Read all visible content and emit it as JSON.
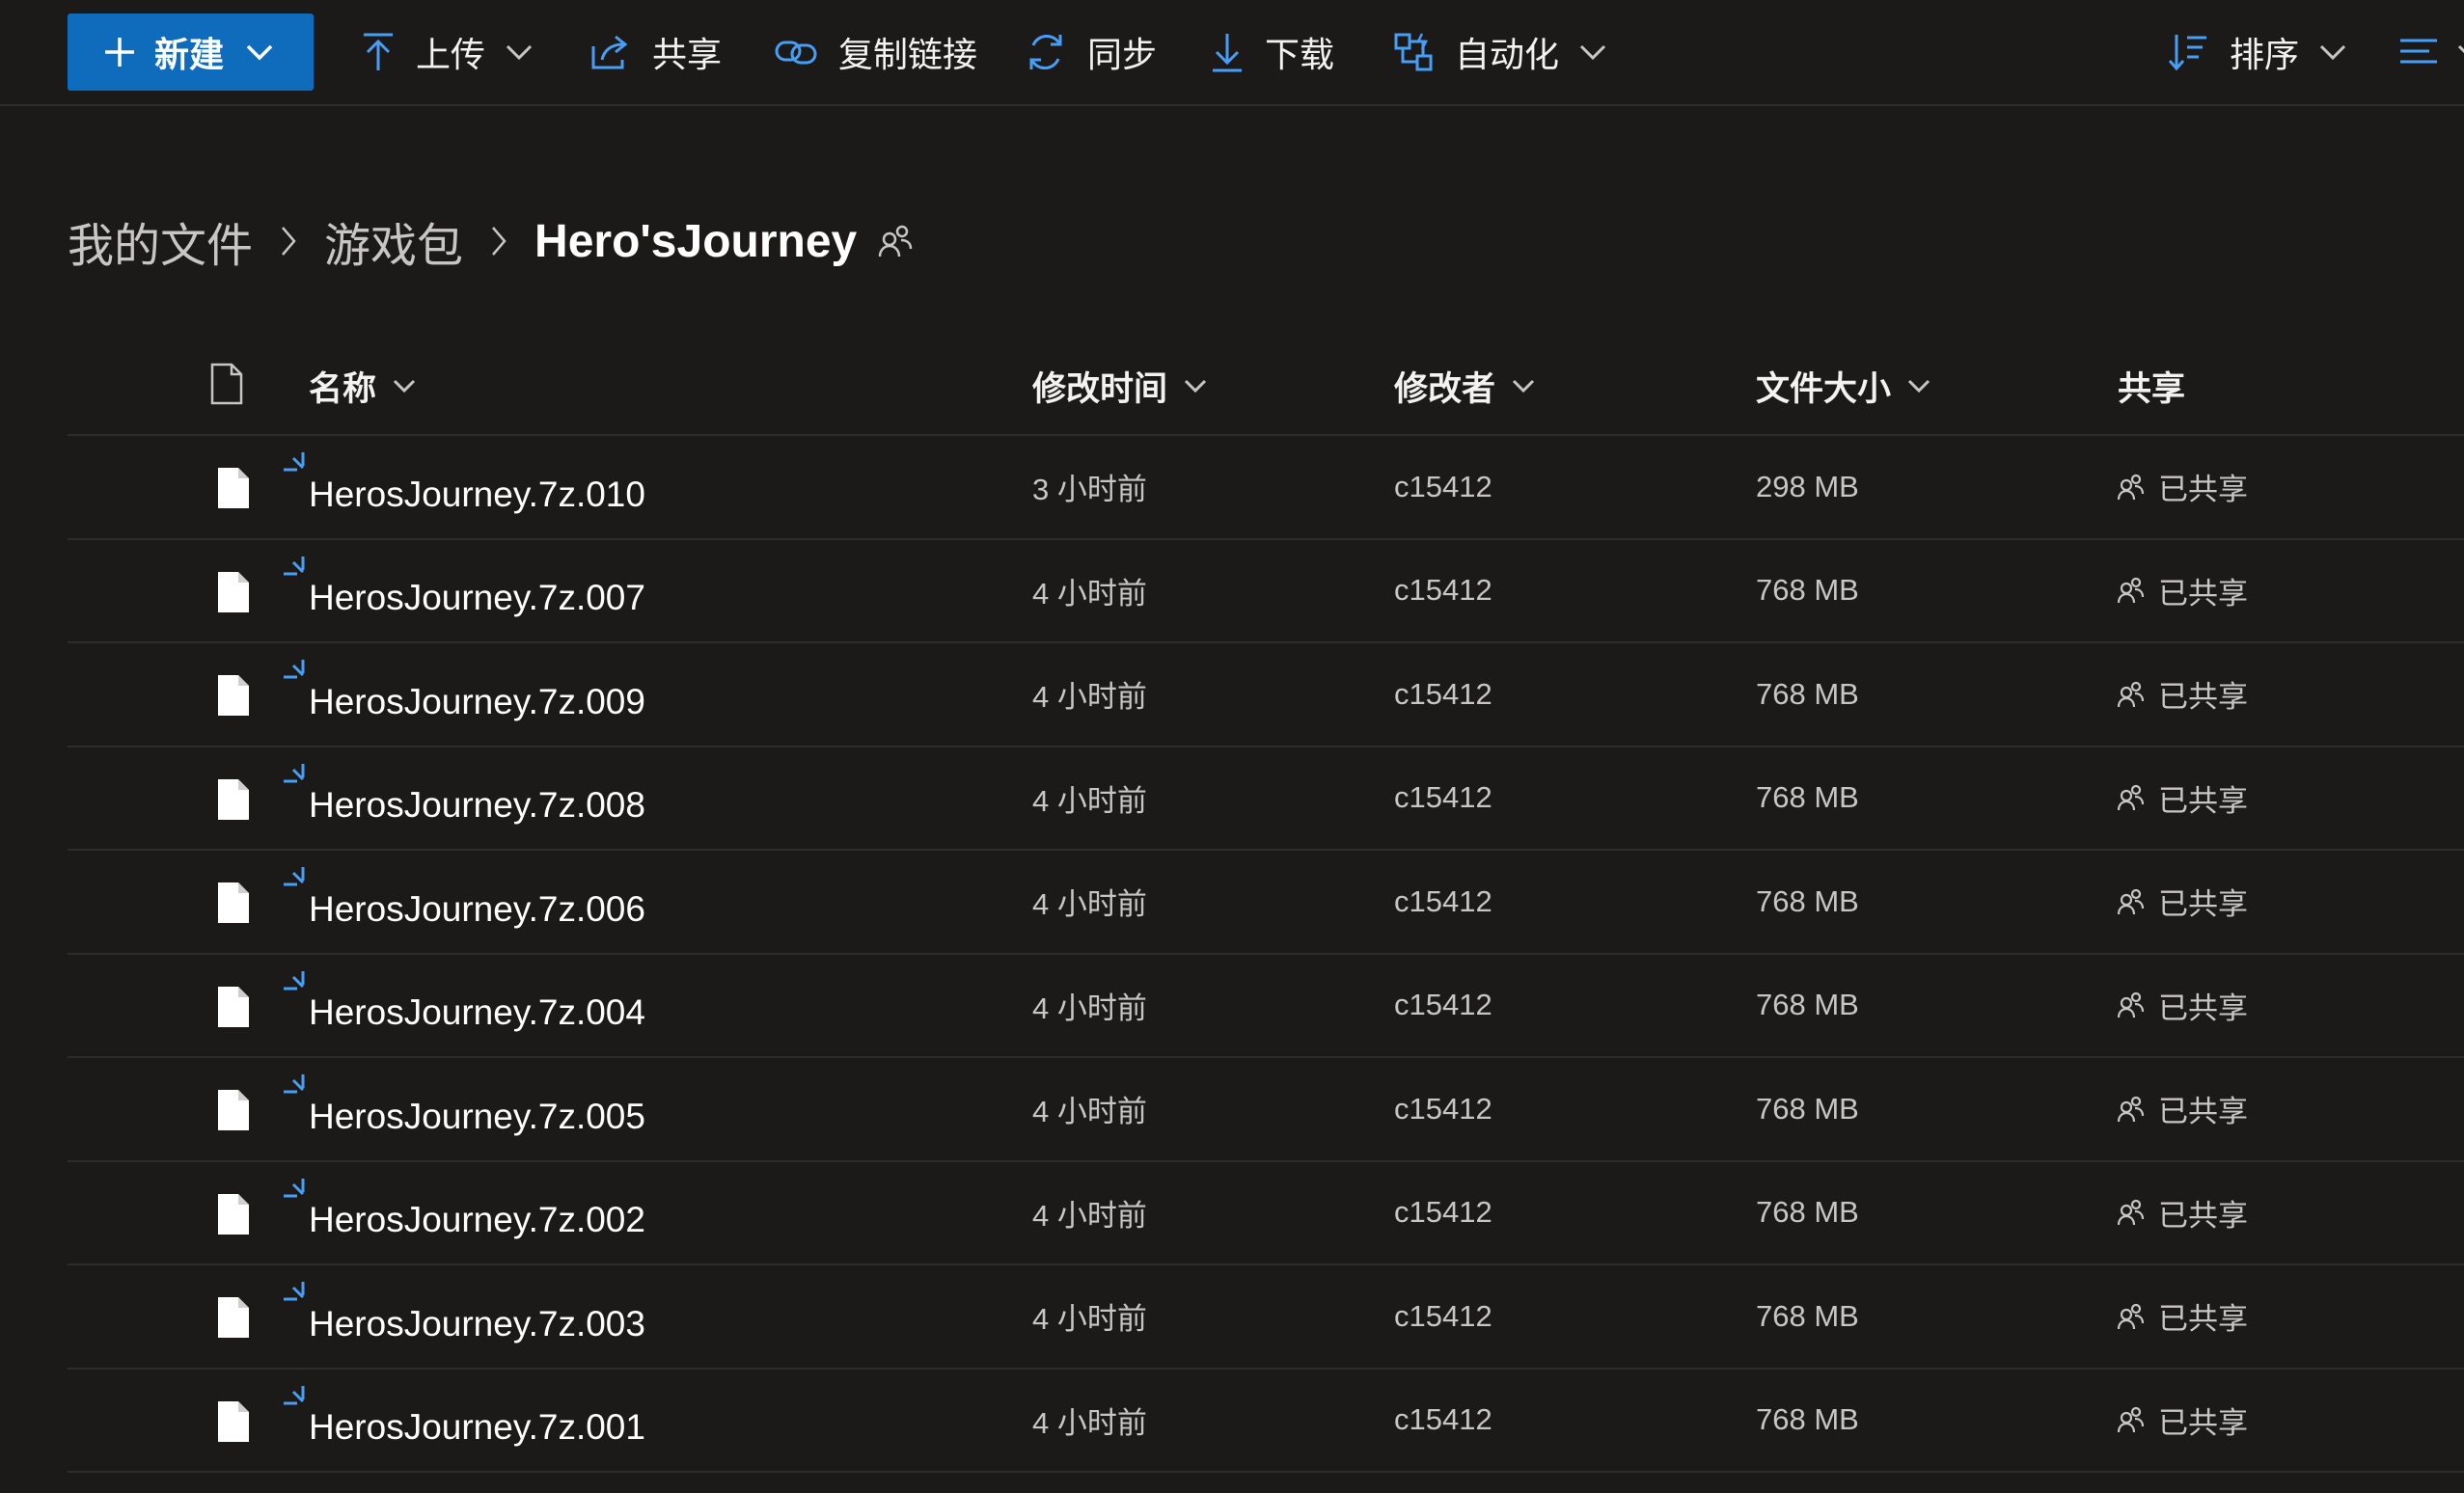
{
  "toolbar": {
    "new_label": "新建",
    "upload_label": "上传",
    "share_label": "共享",
    "copy_link_label": "复制链接",
    "sync_label": "同步",
    "download_label": "下载",
    "automate_label": "自动化",
    "sort_label": "排序"
  },
  "breadcrumb": {
    "items": [
      "我的文件",
      "游戏包",
      "Hero'sJourney"
    ]
  },
  "table": {
    "headers": {
      "name": "名称",
      "modified": "修改时间",
      "modified_by": "修改者",
      "size": "文件大小",
      "sharing": "共享"
    },
    "rows": [
      {
        "name": "HerosJourney.7z.010",
        "modified": "3 小时前",
        "modified_by": "c15412",
        "size": "298 MB",
        "sharing": "已共享"
      },
      {
        "name": "HerosJourney.7z.007",
        "modified": "4 小时前",
        "modified_by": "c15412",
        "size": "768 MB",
        "sharing": "已共享"
      },
      {
        "name": "HerosJourney.7z.009",
        "modified": "4 小时前",
        "modified_by": "c15412",
        "size": "768 MB",
        "sharing": "已共享"
      },
      {
        "name": "HerosJourney.7z.008",
        "modified": "4 小时前",
        "modified_by": "c15412",
        "size": "768 MB",
        "sharing": "已共享"
      },
      {
        "name": "HerosJourney.7z.006",
        "modified": "4 小时前",
        "modified_by": "c15412",
        "size": "768 MB",
        "sharing": "已共享"
      },
      {
        "name": "HerosJourney.7z.004",
        "modified": "4 小时前",
        "modified_by": "c15412",
        "size": "768 MB",
        "sharing": "已共享"
      },
      {
        "name": "HerosJourney.7z.005",
        "modified": "4 小时前",
        "modified_by": "c15412",
        "size": "768 MB",
        "sharing": "已共享"
      },
      {
        "name": "HerosJourney.7z.002",
        "modified": "4 小时前",
        "modified_by": "c15412",
        "size": "768 MB",
        "sharing": "已共享"
      },
      {
        "name": "HerosJourney.7z.003",
        "modified": "4 小时前",
        "modified_by": "c15412",
        "size": "768 MB",
        "sharing": "已共享"
      },
      {
        "name": "HerosJourney.7z.001",
        "modified": "4 小时前",
        "modified_by": "c15412",
        "size": "768 MB",
        "sharing": "已共享"
      }
    ]
  },
  "colors": {
    "background": "#1b1a19",
    "accent": "#0f6cbd",
    "icon_blue": "#479ef5",
    "divider": "#2d2c2b"
  },
  "icons": {
    "toolbar": [
      "plus-icon",
      "upload-icon",
      "share-icon",
      "link-icon",
      "sync-icon",
      "download-icon",
      "automate-icon",
      "sort-icon",
      "view-options-icon"
    ],
    "row": [
      "file-icon",
      "new-sync-icon",
      "people-icon"
    ]
  }
}
